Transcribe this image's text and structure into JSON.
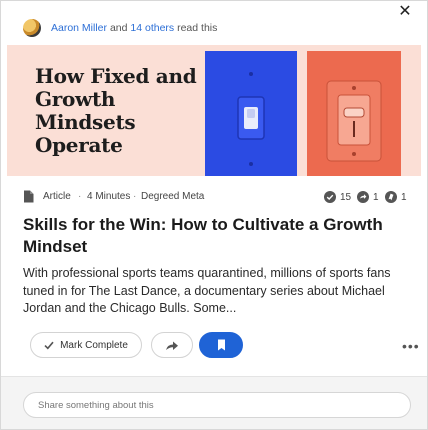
{
  "header": {
    "reader_name": "Aaron Miller",
    "reader_join": " and ",
    "others_label": "14 others",
    "read_suffix": " read this",
    "close_glyph": "✕"
  },
  "hero": {
    "title": "How Fixed and Growth Mindsets Operate"
  },
  "meta": {
    "type_label": "Article",
    "duration": "4 Minutes",
    "separator": "·",
    "source": "Degreed Meta",
    "completions_count": "15",
    "shares_count": "1",
    "saves_count": "1"
  },
  "article": {
    "title": "Skills for the Win: How to Cultivate a Growth Mindset",
    "description": "With professional sports teams quarantined, millions of sports fans tuned in for The Last Dance, a documentary series about Michael Jordan and the Chicago Bulls. Some..."
  },
  "actions": {
    "mark_complete_label": "Mark Complete",
    "more_glyph": "•••"
  },
  "comment": {
    "placeholder": "Share something about this"
  },
  "colors": {
    "accent_blue": "#1f63d6",
    "hero_pink": "#fbdfd6",
    "panel_blue": "#2b4be3",
    "panel_red": "#ec6a4f"
  }
}
